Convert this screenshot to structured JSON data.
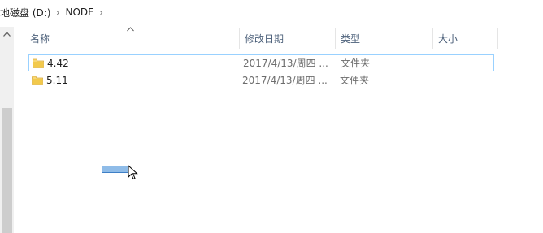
{
  "breadcrumb": {
    "drive": "地磁盘 (D:)",
    "folder": "NODE"
  },
  "columns": {
    "name": "名称",
    "date": "修改日期",
    "type": "类型",
    "size": "大小"
  },
  "rows": [
    {
      "name": "4.42",
      "date": "2017/4/13/周四 ...",
      "type": "文件夹",
      "size": ""
    },
    {
      "name": "5.11",
      "date": "2017/4/13/周四 ...",
      "type": "文件夹",
      "size": ""
    }
  ],
  "colors": {
    "folder": "#f2c94c",
    "selection_border": "#99d1ff",
    "drag_fill": "#8fbce8"
  },
  "icons": {
    "chevron": "chevron-right-icon",
    "folder": "folder-icon",
    "cursor": "arrow-cursor-icon"
  }
}
